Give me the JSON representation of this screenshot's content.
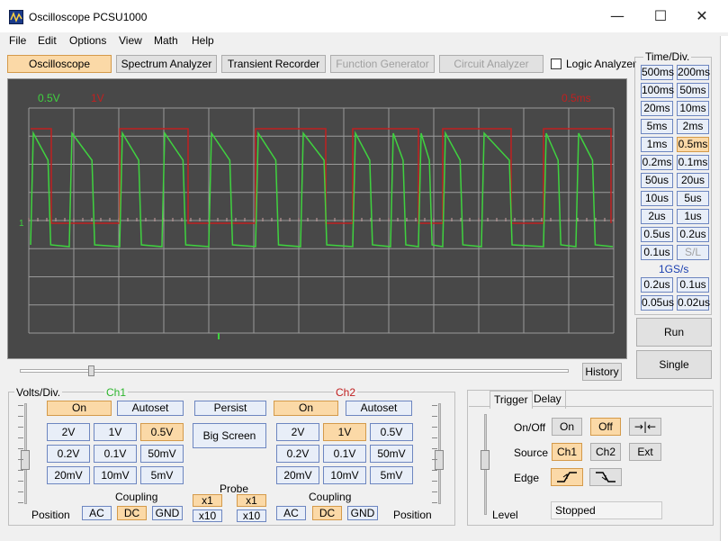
{
  "window": {
    "title": "Oscilloscope PCSU1000",
    "minimize": "—",
    "maximize": "☐",
    "close": "✕"
  },
  "menu": [
    "File",
    "Edit",
    "Options",
    "View",
    "Math",
    "Help"
  ],
  "tabs": {
    "oscilloscope": "Oscilloscope",
    "spectrum": "Spectrum Analyzer",
    "transient": "Transient Recorder",
    "function_gen": "Function Generator",
    "circuit": "Circuit Analyzer",
    "logic": "Logic Analyzer"
  },
  "scope": {
    "ch1_scale": "0.5V",
    "ch2_scale": "1V",
    "time_scale": "0.5ms",
    "ch1_marker": "1",
    "colors": {
      "ch1": "#3fd23f",
      "ch2": "#c02020",
      "grid": "#9a9a9a",
      "screen": "#484848"
    }
  },
  "history_button": "History",
  "timediv": {
    "title": "Time/Div.",
    "rows": [
      [
        "500ms",
        "200ms"
      ],
      [
        "100ms",
        "50ms"
      ],
      [
        "20ms",
        "10ms"
      ],
      [
        "5ms",
        "2ms"
      ],
      [
        "1ms",
        "0.5ms"
      ],
      [
        "0.2ms",
        "0.1ms"
      ],
      [
        "50us",
        "20us"
      ],
      [
        "10us",
        "5us"
      ],
      [
        "2us",
        "1us"
      ],
      [
        "0.5us",
        "0.2us"
      ],
      [
        "0.1us",
        "S/L"
      ]
    ],
    "gs_label": "1GS/s",
    "gs_rows": [
      [
        "0.2us",
        "0.1us"
      ],
      [
        "0.05us",
        "0.02us"
      ]
    ],
    "selected": "0.5ms",
    "run": "Run",
    "single": "Single"
  },
  "volts": {
    "title": "Volts/Div.",
    "ch1_label": "Ch1",
    "ch2_label": "Ch2",
    "on": "On",
    "autoset": "Autoset",
    "persist": "Persist",
    "big_screen": "Big Screen",
    "grid": [
      [
        "2V",
        "1V",
        "0.5V"
      ],
      [
        "0.2V",
        "0.1V",
        "50mV"
      ],
      [
        "20mV",
        "10mV",
        "5mV"
      ]
    ],
    "ch1_selected": "0.5V",
    "ch2_selected": "1V",
    "coupling": "Coupling",
    "coupling_opts": [
      "AC",
      "DC",
      "GND"
    ],
    "coupling_selected": "DC",
    "probe": "Probe",
    "x1": "x1",
    "x10": "x10",
    "position": "Position"
  },
  "trigger": {
    "tab_trigger": "Trigger",
    "tab_delay": "Delay",
    "onoff_label": "On/Off",
    "on": "On",
    "off": "Off",
    "center_icon": "→|←",
    "source_label": "Source",
    "sources": [
      "Ch1",
      "Ch2",
      "Ext"
    ],
    "edge_label": "Edge",
    "level_label": "Level",
    "status": "Stopped"
  }
}
